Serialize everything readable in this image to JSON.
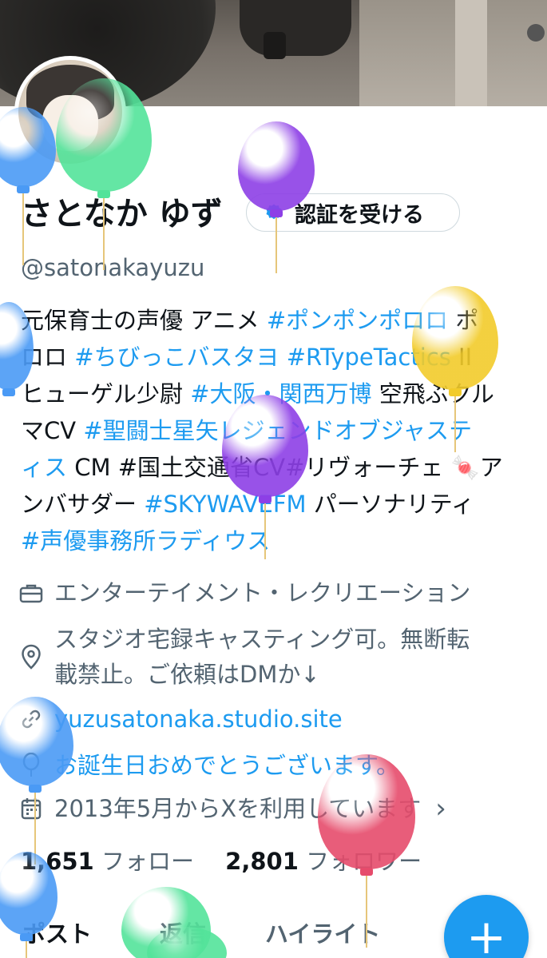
{
  "profile": {
    "name": "さとなか ゆず",
    "handle": "@satonakayuzu",
    "verify_button": "認証を受ける"
  },
  "bio": {
    "lines": [
      [
        {
          "t": "元保育士の声優 アニメ ",
          "tag": false
        },
        {
          "t": "#ポンポンポロロ",
          "tag": true
        },
        {
          "t": " ポ",
          "tag": false
        }
      ],
      [
        {
          "t": "ロロ ",
          "tag": false
        },
        {
          "t": "#ちびっこバスタヨ",
          "tag": true
        },
        {
          "t": " ",
          "tag": false
        },
        {
          "t": "#RTypeTactics",
          "tag": true
        },
        {
          "t": " II",
          "tag": false
        }
      ],
      [
        {
          "t": "ヒューゲル少尉 ",
          "tag": false
        },
        {
          "t": "#大阪・関西万博",
          "tag": true
        },
        {
          "t": " 空飛ぶクル",
          "tag": false
        }
      ],
      [
        {
          "t": "マCV ",
          "tag": false
        },
        {
          "t": "#聖闘士星矢レジェンドオブジャステ",
          "tag": true
        }
      ],
      [
        {
          "t": "ィス",
          "tag": true
        },
        {
          "t": " CM #国土交通省CV#リヴォーチェ 🍬ア",
          "tag": false
        }
      ],
      [
        {
          "t": "ンバサダー ",
          "tag": false
        },
        {
          "t": "#SKYWAVEFM",
          "tag": true
        },
        {
          "t": " パーソナリティ",
          "tag": false
        }
      ],
      [
        {
          "t": "#声優事務所ラディウス",
          "tag": true
        }
      ]
    ]
  },
  "meta": {
    "category": "エンターテイメント・レクリエーション",
    "location_line1": "スタジオ宅録キャスティング可。無断転",
    "location_line2": "載禁止。ご依頼はDMか↓",
    "website": "yuzusatonaka.studio.site",
    "birthday": "お誕生日おめでとうございます。",
    "joined": "2013年5月からXを利用しています",
    "joined_chevron": "›"
  },
  "follows": {
    "following_count": "1,651",
    "following_label": " フォロー",
    "followers_count": "2,801",
    "followers_label": " フォロワー"
  },
  "tabs": {
    "posts": "ポスト",
    "replies": "返信",
    "highlights": "ハイライト"
  },
  "fab": {
    "label": "+"
  },
  "colors": {
    "accent": "#1d9bf0",
    "secondary_text": "#536471",
    "primary_text": "#0f1419"
  },
  "icons": [
    "briefcase-icon",
    "location-pin-icon",
    "link-icon",
    "balloon-icon",
    "calendar-icon",
    "verified-badge-icon",
    "plus-icon",
    "chevron-right-icon"
  ]
}
